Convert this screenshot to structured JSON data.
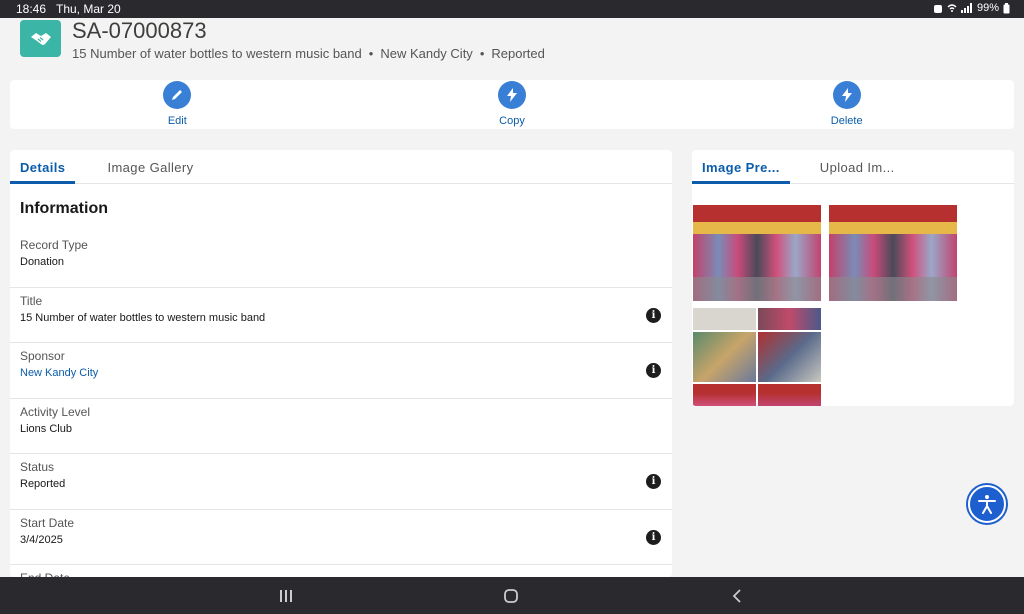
{
  "status_bar": {
    "time": "18:46",
    "date": "Thu, Mar 20",
    "battery": "99%"
  },
  "header": {
    "title": "SA-07000873",
    "subtitle_parts": [
      "15 Number of water bottles to western music band",
      "New Kandy City",
      "Reported"
    ],
    "separator": "•",
    "icon": "handshake-icon"
  },
  "actions": [
    {
      "label": "Edit",
      "icon": "pencil-icon"
    },
    {
      "label": "Copy",
      "icon": "lightning-icon"
    },
    {
      "label": "Delete",
      "icon": "lightning-icon"
    }
  ],
  "left_tabs": {
    "details": "Details",
    "gallery": "Image Gallery"
  },
  "section_title": "Information",
  "fields": [
    {
      "label": "Record Type",
      "value": "Donation",
      "link": false,
      "info": false
    },
    {
      "label": "Title",
      "value": "15 Number of water bottles to western music band",
      "link": false,
      "info": true
    },
    {
      "label": "Sponsor",
      "value": "New Kandy City",
      "link": true,
      "info": true
    },
    {
      "label": "Activity Level",
      "value": "Lions Club",
      "link": false,
      "info": false
    },
    {
      "label": "Status",
      "value": "Reported",
      "link": false,
      "info": true
    },
    {
      "label": "Start Date",
      "value": "3/4/2025",
      "link": false,
      "info": true
    },
    {
      "label": "End Date",
      "value": "",
      "link": false,
      "info": true
    }
  ],
  "info_glyph": "i",
  "right_tabs": {
    "preview": "Image Pre...",
    "upload": "Upload Im..."
  },
  "colors": {
    "accent": "#0b5cab",
    "icon_bg": "#3a7fd6",
    "object_icon": "#3bb5a5"
  }
}
